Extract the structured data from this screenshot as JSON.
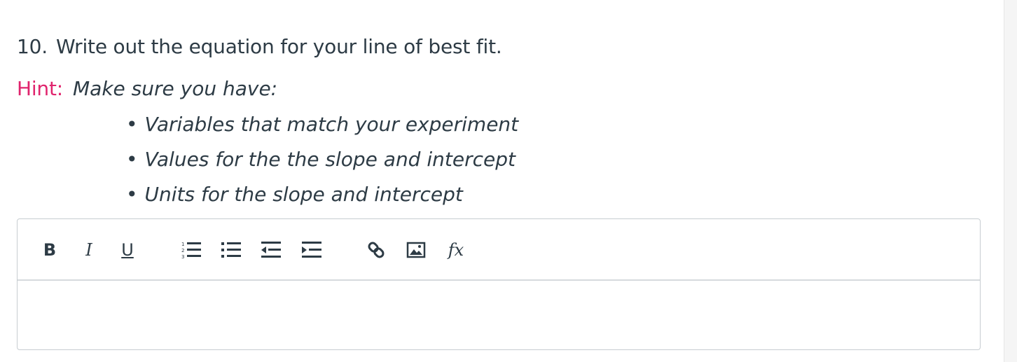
{
  "question": {
    "number": "10.",
    "text": "Write out the equation for your line of best fit."
  },
  "hint": {
    "label": "Hint:",
    "text": "Make sure you have:",
    "items": [
      "Variables that match your experiment",
      "Values for the the slope and intercept",
      "Units for the slope and intercept"
    ],
    "bullet": "•"
  },
  "toolbar": {
    "bold": "B",
    "italic": "I",
    "underline": "U",
    "formula": "fx",
    "icons": [
      "numbered-list-icon",
      "bulleted-list-icon",
      "outdent-icon",
      "indent-icon",
      "link-icon",
      "image-icon",
      "formula-icon"
    ]
  },
  "editor": {
    "value": ""
  },
  "colors": {
    "hint": "#e0246d",
    "text": "#2d3b45",
    "border": "#c7cdd1"
  }
}
